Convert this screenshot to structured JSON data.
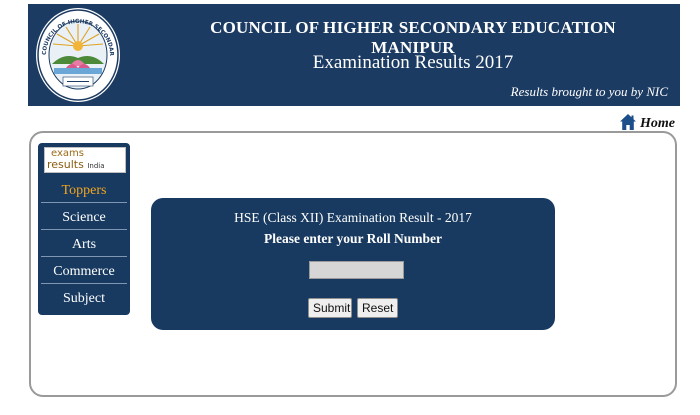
{
  "header": {
    "title": "COUNCIL OF HIGHER SECONDARY EDUCATION MANIPUR",
    "subtitle": "Examination Results 2017",
    "credit": "Results brought to you by NIC",
    "logo_text": "COUNCIL OF HIGHER SECONDARY EDUCATION MANIPUR"
  },
  "home": {
    "label": "Home",
    "icon": "home-icon"
  },
  "sidebar": {
    "logo_top": "exams",
    "logo_bottom": "results",
    "logo_suffix": "India",
    "items": [
      {
        "label": "Toppers",
        "active": true
      },
      {
        "label": "Science",
        "active": false
      },
      {
        "label": "Arts",
        "active": false
      },
      {
        "label": "Commerce",
        "active": false
      },
      {
        "label": "Subject",
        "active": false
      }
    ]
  },
  "form": {
    "title": "HSE (Class XII) Examination Result - 2017",
    "prompt": "Please enter your Roll Number",
    "roll_value": "",
    "submit_label": "Submit",
    "reset_label": "Reset"
  },
  "colors": {
    "banner": "#1c3b62",
    "panel": "#183a60",
    "active_nav": "#f3a51f"
  }
}
